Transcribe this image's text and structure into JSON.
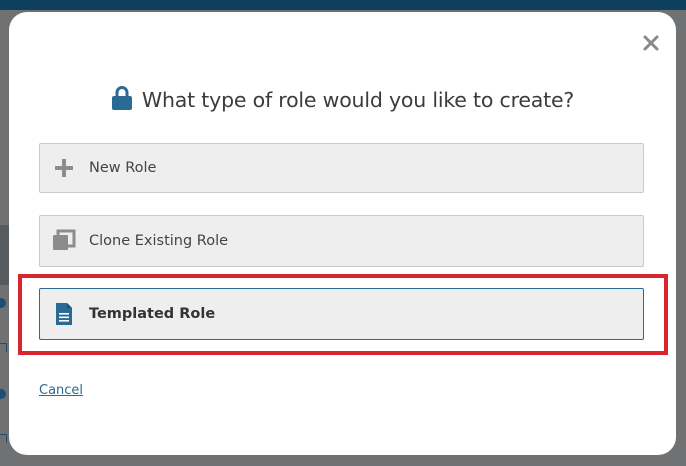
{
  "dialog": {
    "title": "What type of role would you like to create?",
    "close_icon": "close-icon",
    "title_icon": "lock-icon",
    "options": [
      {
        "label": "New Role",
        "icon": "plus-icon"
      },
      {
        "label": "Clone Existing Role",
        "icon": "clone-icon"
      },
      {
        "label": "Templated Role",
        "icon": "document-icon",
        "selected": true
      }
    ],
    "cancel_label": "Cancel"
  },
  "colors": {
    "accent": "#2a6a94",
    "highlight": "#d9262e",
    "overlay": "#6f7173",
    "header": "#0f3f5e"
  }
}
